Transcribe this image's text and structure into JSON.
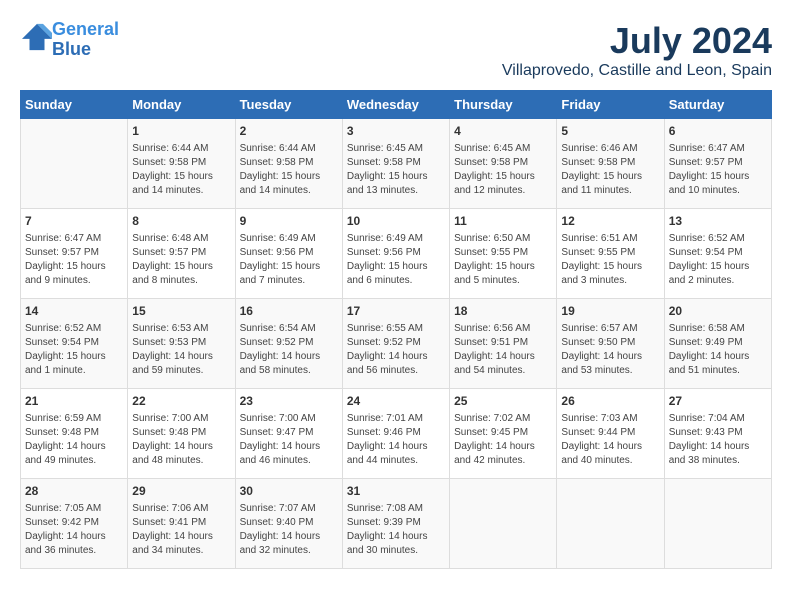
{
  "header": {
    "logo_line1": "General",
    "logo_line2": "Blue",
    "main_title": "July 2024",
    "subtitle": "Villaprovedo, Castille and Leon, Spain"
  },
  "columns": [
    "Sunday",
    "Monday",
    "Tuesday",
    "Wednesday",
    "Thursday",
    "Friday",
    "Saturday"
  ],
  "weeks": [
    [
      {
        "day": "",
        "info": ""
      },
      {
        "day": "1",
        "info": "Sunrise: 6:44 AM\nSunset: 9:58 PM\nDaylight: 15 hours\nand 14 minutes."
      },
      {
        "day": "2",
        "info": "Sunrise: 6:44 AM\nSunset: 9:58 PM\nDaylight: 15 hours\nand 14 minutes."
      },
      {
        "day": "3",
        "info": "Sunrise: 6:45 AM\nSunset: 9:58 PM\nDaylight: 15 hours\nand 13 minutes."
      },
      {
        "day": "4",
        "info": "Sunrise: 6:45 AM\nSunset: 9:58 PM\nDaylight: 15 hours\nand 12 minutes."
      },
      {
        "day": "5",
        "info": "Sunrise: 6:46 AM\nSunset: 9:58 PM\nDaylight: 15 hours\nand 11 minutes."
      },
      {
        "day": "6",
        "info": "Sunrise: 6:47 AM\nSunset: 9:57 PM\nDaylight: 15 hours\nand 10 minutes."
      }
    ],
    [
      {
        "day": "7",
        "info": "Sunrise: 6:47 AM\nSunset: 9:57 PM\nDaylight: 15 hours\nand 9 minutes."
      },
      {
        "day": "8",
        "info": "Sunrise: 6:48 AM\nSunset: 9:57 PM\nDaylight: 15 hours\nand 8 minutes."
      },
      {
        "day": "9",
        "info": "Sunrise: 6:49 AM\nSunset: 9:56 PM\nDaylight: 15 hours\nand 7 minutes."
      },
      {
        "day": "10",
        "info": "Sunrise: 6:49 AM\nSunset: 9:56 PM\nDaylight: 15 hours\nand 6 minutes."
      },
      {
        "day": "11",
        "info": "Sunrise: 6:50 AM\nSunset: 9:55 PM\nDaylight: 15 hours\nand 5 minutes."
      },
      {
        "day": "12",
        "info": "Sunrise: 6:51 AM\nSunset: 9:55 PM\nDaylight: 15 hours\nand 3 minutes."
      },
      {
        "day": "13",
        "info": "Sunrise: 6:52 AM\nSunset: 9:54 PM\nDaylight: 15 hours\nand 2 minutes."
      }
    ],
    [
      {
        "day": "14",
        "info": "Sunrise: 6:52 AM\nSunset: 9:54 PM\nDaylight: 15 hours\nand 1 minute."
      },
      {
        "day": "15",
        "info": "Sunrise: 6:53 AM\nSunset: 9:53 PM\nDaylight: 14 hours\nand 59 minutes."
      },
      {
        "day": "16",
        "info": "Sunrise: 6:54 AM\nSunset: 9:52 PM\nDaylight: 14 hours\nand 58 minutes."
      },
      {
        "day": "17",
        "info": "Sunrise: 6:55 AM\nSunset: 9:52 PM\nDaylight: 14 hours\nand 56 minutes."
      },
      {
        "day": "18",
        "info": "Sunrise: 6:56 AM\nSunset: 9:51 PM\nDaylight: 14 hours\nand 54 minutes."
      },
      {
        "day": "19",
        "info": "Sunrise: 6:57 AM\nSunset: 9:50 PM\nDaylight: 14 hours\nand 53 minutes."
      },
      {
        "day": "20",
        "info": "Sunrise: 6:58 AM\nSunset: 9:49 PM\nDaylight: 14 hours\nand 51 minutes."
      }
    ],
    [
      {
        "day": "21",
        "info": "Sunrise: 6:59 AM\nSunset: 9:48 PM\nDaylight: 14 hours\nand 49 minutes."
      },
      {
        "day": "22",
        "info": "Sunrise: 7:00 AM\nSunset: 9:48 PM\nDaylight: 14 hours\nand 48 minutes."
      },
      {
        "day": "23",
        "info": "Sunrise: 7:00 AM\nSunset: 9:47 PM\nDaylight: 14 hours\nand 46 minutes."
      },
      {
        "day": "24",
        "info": "Sunrise: 7:01 AM\nSunset: 9:46 PM\nDaylight: 14 hours\nand 44 minutes."
      },
      {
        "day": "25",
        "info": "Sunrise: 7:02 AM\nSunset: 9:45 PM\nDaylight: 14 hours\nand 42 minutes."
      },
      {
        "day": "26",
        "info": "Sunrise: 7:03 AM\nSunset: 9:44 PM\nDaylight: 14 hours\nand 40 minutes."
      },
      {
        "day": "27",
        "info": "Sunrise: 7:04 AM\nSunset: 9:43 PM\nDaylight: 14 hours\nand 38 minutes."
      }
    ],
    [
      {
        "day": "28",
        "info": "Sunrise: 7:05 AM\nSunset: 9:42 PM\nDaylight: 14 hours\nand 36 minutes."
      },
      {
        "day": "29",
        "info": "Sunrise: 7:06 AM\nSunset: 9:41 PM\nDaylight: 14 hours\nand 34 minutes."
      },
      {
        "day": "30",
        "info": "Sunrise: 7:07 AM\nSunset: 9:40 PM\nDaylight: 14 hours\nand 32 minutes."
      },
      {
        "day": "31",
        "info": "Sunrise: 7:08 AM\nSunset: 9:39 PM\nDaylight: 14 hours\nand 30 minutes."
      },
      {
        "day": "",
        "info": ""
      },
      {
        "day": "",
        "info": ""
      },
      {
        "day": "",
        "info": ""
      }
    ]
  ]
}
